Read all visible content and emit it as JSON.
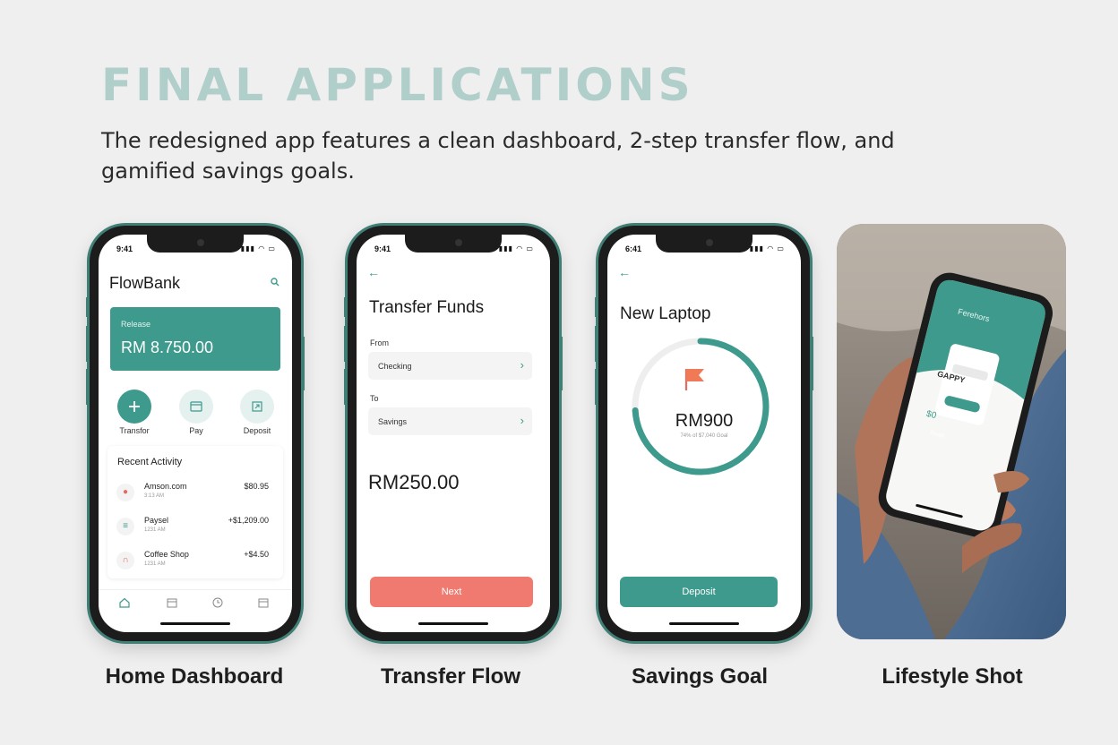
{
  "header": {
    "title": "FINAL APPLICATIONS",
    "subtitle": "The redesigned app features a clean dashboard, 2-step transfer flow, and gamified savings goals."
  },
  "colors": {
    "accent": "#3d9a8c",
    "title": "#b1cfca",
    "cta_coral": "#f07a70",
    "frame": "#3f7f76"
  },
  "captions": {
    "home": "Home Dashboard",
    "transfer": "Transfer Flow",
    "savings": "Savings Goal",
    "lifestyle": "Lifestyle Shot"
  },
  "home": {
    "status_time": "9:41",
    "brand": "FlowBank",
    "balance_label": "Release",
    "balance_amount": "RM 8.750.00",
    "actions": [
      {
        "label": "Transfor",
        "icon": "plus-icon"
      },
      {
        "label": "Pay",
        "icon": "card-icon"
      },
      {
        "label": "Deposit",
        "icon": "deposit-icon"
      }
    ],
    "recent_title": "Recent Activity",
    "transactions": [
      {
        "name": "Amson.com",
        "time": "3:13 AM",
        "amount": "$80.95",
        "icon": "shopping-icon"
      },
      {
        "name": "Paysel",
        "time": "1231 AM",
        "amount": "+$1,209.00",
        "icon": "list-icon"
      },
      {
        "name": "Coffee Shop",
        "time": "1231 AM",
        "amount": "+$4.50",
        "icon": "coffee-icon"
      }
    ]
  },
  "transfer": {
    "status_time": "9:41",
    "title": "Transfer Funds",
    "from_label": "From",
    "from_value": "Checking",
    "to_label": "To",
    "to_value": "Savings",
    "amount": "RM250.00",
    "next_label": "Next"
  },
  "savings": {
    "status_time": "6:41",
    "title": "New Laptop",
    "amount": "RM900",
    "progress_text": "74% of $7,040 Goal",
    "progress": 0.74,
    "deposit_label": "Deposit"
  },
  "lifestyle": {
    "screen_header": "Ferehors",
    "card_title": "GAPPY",
    "card_amount": "$0",
    "card_button": "Reait"
  }
}
